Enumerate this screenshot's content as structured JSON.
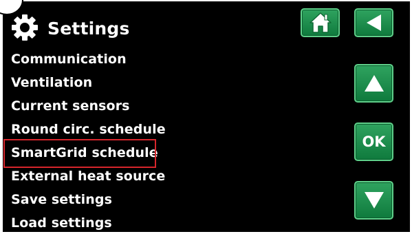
{
  "header": {
    "title": "Settings",
    "icon": "gear-icon"
  },
  "menu": {
    "items": [
      {
        "label": "Communication"
      },
      {
        "label": "Ventilation"
      },
      {
        "label": "Current sensors"
      },
      {
        "label": "Round circ. schedule"
      },
      {
        "label": "SmartGrid schedule",
        "highlighted": true
      },
      {
        "label": "External heat source"
      },
      {
        "label": "Save settings"
      },
      {
        "label": "Load settings"
      }
    ]
  },
  "buttons": {
    "home": {
      "icon": "home-icon"
    },
    "back": {
      "icon": "back-arrow-icon"
    },
    "up": {
      "icon": "up-arrow-icon"
    },
    "ok": {
      "label": "OK"
    },
    "down": {
      "icon": "down-arrow-icon"
    }
  },
  "colors": {
    "background": "#000000",
    "text": "#ffffff",
    "button_green": "#1e8f4d",
    "highlight": "#d8262c"
  }
}
